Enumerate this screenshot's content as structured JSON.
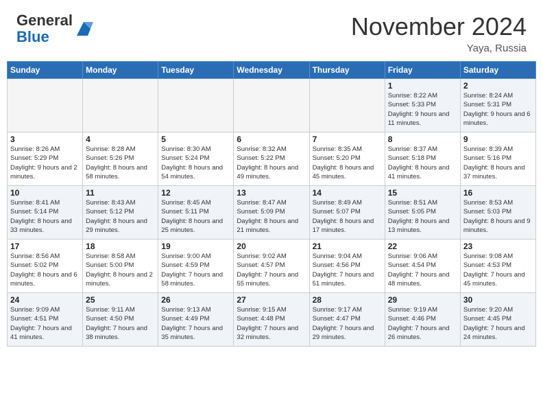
{
  "header": {
    "logo_general": "General",
    "logo_blue": "Blue",
    "month_year": "November 2024",
    "location": "Yaya, Russia"
  },
  "days_of_week": [
    "Sunday",
    "Monday",
    "Tuesday",
    "Wednesday",
    "Thursday",
    "Friday",
    "Saturday"
  ],
  "weeks": [
    [
      {
        "num": "",
        "info": ""
      },
      {
        "num": "",
        "info": ""
      },
      {
        "num": "",
        "info": ""
      },
      {
        "num": "",
        "info": ""
      },
      {
        "num": "",
        "info": ""
      },
      {
        "num": "1",
        "info": "Sunrise: 8:22 AM\nSunset: 5:33 PM\nDaylight: 9 hours and 11 minutes."
      },
      {
        "num": "2",
        "info": "Sunrise: 8:24 AM\nSunset: 5:31 PM\nDaylight: 9 hours and 6 minutes."
      }
    ],
    [
      {
        "num": "3",
        "info": "Sunrise: 8:26 AM\nSunset: 5:29 PM\nDaylight: 9 hours and 2 minutes."
      },
      {
        "num": "4",
        "info": "Sunrise: 8:28 AM\nSunset: 5:26 PM\nDaylight: 8 hours and 58 minutes."
      },
      {
        "num": "5",
        "info": "Sunrise: 8:30 AM\nSunset: 5:24 PM\nDaylight: 8 hours and 54 minutes."
      },
      {
        "num": "6",
        "info": "Sunrise: 8:32 AM\nSunset: 5:22 PM\nDaylight: 8 hours and 49 minutes."
      },
      {
        "num": "7",
        "info": "Sunrise: 8:35 AM\nSunset: 5:20 PM\nDaylight: 8 hours and 45 minutes."
      },
      {
        "num": "8",
        "info": "Sunrise: 8:37 AM\nSunset: 5:18 PM\nDaylight: 8 hours and 41 minutes."
      },
      {
        "num": "9",
        "info": "Sunrise: 8:39 AM\nSunset: 5:16 PM\nDaylight: 8 hours and 37 minutes."
      }
    ],
    [
      {
        "num": "10",
        "info": "Sunrise: 8:41 AM\nSunset: 5:14 PM\nDaylight: 8 hours and 33 minutes."
      },
      {
        "num": "11",
        "info": "Sunrise: 8:43 AM\nSunset: 5:12 PM\nDaylight: 8 hours and 29 minutes."
      },
      {
        "num": "12",
        "info": "Sunrise: 8:45 AM\nSunset: 5:11 PM\nDaylight: 8 hours and 25 minutes."
      },
      {
        "num": "13",
        "info": "Sunrise: 8:47 AM\nSunset: 5:09 PM\nDaylight: 8 hours and 21 minutes."
      },
      {
        "num": "14",
        "info": "Sunrise: 8:49 AM\nSunset: 5:07 PM\nDaylight: 8 hours and 17 minutes."
      },
      {
        "num": "15",
        "info": "Sunrise: 8:51 AM\nSunset: 5:05 PM\nDaylight: 8 hours and 13 minutes."
      },
      {
        "num": "16",
        "info": "Sunrise: 8:53 AM\nSunset: 5:03 PM\nDaylight: 8 hours and 9 minutes."
      }
    ],
    [
      {
        "num": "17",
        "info": "Sunrise: 8:56 AM\nSunset: 5:02 PM\nDaylight: 8 hours and 6 minutes."
      },
      {
        "num": "18",
        "info": "Sunrise: 8:58 AM\nSunset: 5:00 PM\nDaylight: 8 hours and 2 minutes."
      },
      {
        "num": "19",
        "info": "Sunrise: 9:00 AM\nSunset: 4:59 PM\nDaylight: 7 hours and 58 minutes."
      },
      {
        "num": "20",
        "info": "Sunrise: 9:02 AM\nSunset: 4:57 PM\nDaylight: 7 hours and 55 minutes."
      },
      {
        "num": "21",
        "info": "Sunrise: 9:04 AM\nSunset: 4:56 PM\nDaylight: 7 hours and 51 minutes."
      },
      {
        "num": "22",
        "info": "Sunrise: 9:06 AM\nSunset: 4:54 PM\nDaylight: 7 hours and 48 minutes."
      },
      {
        "num": "23",
        "info": "Sunrise: 9:08 AM\nSunset: 4:53 PM\nDaylight: 7 hours and 45 minutes."
      }
    ],
    [
      {
        "num": "24",
        "info": "Sunrise: 9:09 AM\nSunset: 4:51 PM\nDaylight: 7 hours and 41 minutes."
      },
      {
        "num": "25",
        "info": "Sunrise: 9:11 AM\nSunset: 4:50 PM\nDaylight: 7 hours and 38 minutes."
      },
      {
        "num": "26",
        "info": "Sunrise: 9:13 AM\nSunset: 4:49 PM\nDaylight: 7 hours and 35 minutes."
      },
      {
        "num": "27",
        "info": "Sunrise: 9:15 AM\nSunset: 4:48 PM\nDaylight: 7 hours and 32 minutes."
      },
      {
        "num": "28",
        "info": "Sunrise: 9:17 AM\nSunset: 4:47 PM\nDaylight: 7 hours and 29 minutes."
      },
      {
        "num": "29",
        "info": "Sunrise: 9:19 AM\nSunset: 4:46 PM\nDaylight: 7 hours and 26 minutes."
      },
      {
        "num": "30",
        "info": "Sunrise: 9:20 AM\nSunset: 4:45 PM\nDaylight: 7 hours and 24 minutes."
      }
    ]
  ]
}
